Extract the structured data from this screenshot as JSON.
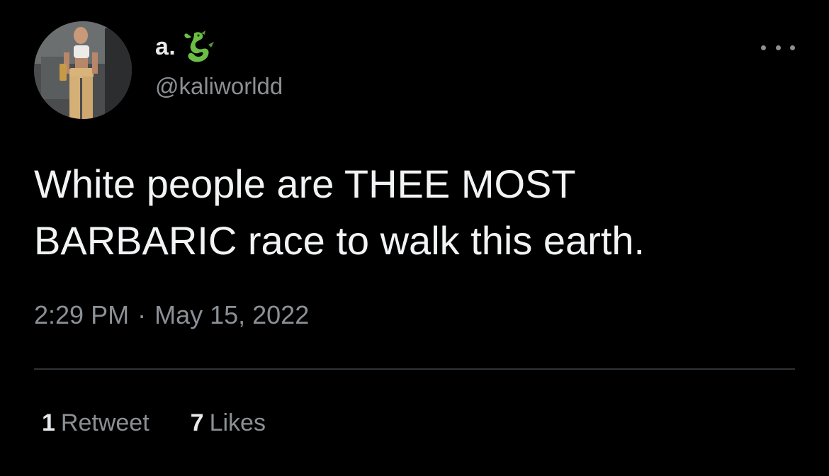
{
  "author": {
    "display_name": "a.",
    "name_emoji": "dragon-emoji",
    "handle": "@kaliworldd",
    "avatar_icon": "profile-photo"
  },
  "menu": {
    "more_icon": "more-horizontal-icon"
  },
  "tweet": {
    "text": "White people are THEE MOST\nBARBARIC race to walk this earth.",
    "time": "2:29 PM",
    "separator": "·",
    "date": "May 15, 2022"
  },
  "stats": {
    "retweets_count": "1",
    "retweets_label": "Retweet",
    "likes_count": "7",
    "likes_label": "Likes"
  },
  "colors": {
    "background": "#000000",
    "primary_text": "#e7e9ea",
    "secondary_text": "#8b9095",
    "divider": "#2f3336",
    "emoji_green": "#6bbd45"
  }
}
